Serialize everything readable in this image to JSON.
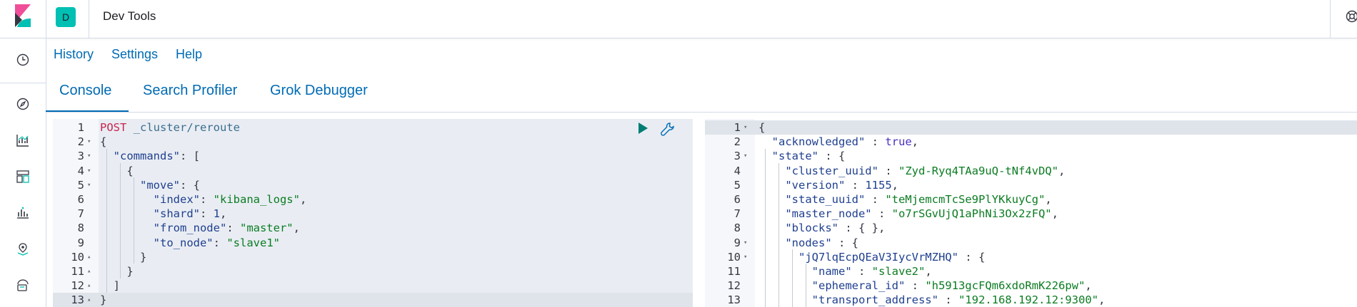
{
  "header": {
    "space_initial": "D",
    "app_title": "Dev Tools",
    "brand_colors": {
      "space": "#00bfb3",
      "link": "#006bb4"
    }
  },
  "nav": {
    "icons": [
      "clock-icon",
      "compass-icon",
      "visualize-icon",
      "dashboard-icon",
      "canvas-icon",
      "maps-icon",
      "ml-icon"
    ]
  },
  "topmenu": {
    "history": "History",
    "settings": "Settings",
    "help": "Help"
  },
  "tabs": [
    {
      "label": "Console",
      "active": true
    },
    {
      "label": "Search Profiler",
      "active": false
    },
    {
      "label": "Grok Debugger",
      "active": false
    }
  ],
  "request": {
    "lines": [
      {
        "n": "1",
        "fold": "",
        "text": [
          [
            "c-method",
            "POST"
          ],
          [
            "c-punc",
            " "
          ],
          [
            "c-url",
            "_cluster/reroute"
          ]
        ]
      },
      {
        "n": "2",
        "fold": "▾",
        "text": [
          [
            "c-punc",
            "{"
          ]
        ]
      },
      {
        "n": "3",
        "fold": "▾",
        "text": [
          [
            "c-punc",
            "  "
          ],
          [
            "c-key",
            "\"commands\""
          ],
          [
            "c-punc",
            ": ["
          ]
        ]
      },
      {
        "n": "4",
        "fold": "▾",
        "text": [
          [
            "c-punc",
            "    {"
          ]
        ]
      },
      {
        "n": "5",
        "fold": "▾",
        "text": [
          [
            "c-punc",
            "      "
          ],
          [
            "c-key",
            "\"move\""
          ],
          [
            "c-punc",
            ": {"
          ]
        ]
      },
      {
        "n": "6",
        "fold": "",
        "text": [
          [
            "c-punc",
            "        "
          ],
          [
            "c-key",
            "\"index\""
          ],
          [
            "c-punc",
            ": "
          ],
          [
            "c-str",
            "\"kibana_logs\""
          ],
          [
            "c-punc",
            ","
          ]
        ]
      },
      {
        "n": "7",
        "fold": "",
        "text": [
          [
            "c-punc",
            "        "
          ],
          [
            "c-key",
            "\"shard\""
          ],
          [
            "c-punc",
            ": "
          ],
          [
            "c-num",
            "1"
          ],
          [
            "c-punc",
            ","
          ]
        ]
      },
      {
        "n": "8",
        "fold": "",
        "text": [
          [
            "c-punc",
            "        "
          ],
          [
            "c-key",
            "\"from_node\""
          ],
          [
            "c-punc",
            ": "
          ],
          [
            "c-str",
            "\"master\""
          ],
          [
            "c-punc",
            ","
          ]
        ]
      },
      {
        "n": "9",
        "fold": "",
        "text": [
          [
            "c-punc",
            "        "
          ],
          [
            "c-key",
            "\"to_node\""
          ],
          [
            "c-punc",
            ": "
          ],
          [
            "c-str",
            "\"slave1\""
          ]
        ]
      },
      {
        "n": "10",
        "fold": "▴",
        "text": [
          [
            "c-punc",
            "      }"
          ]
        ]
      },
      {
        "n": "11",
        "fold": "▴",
        "text": [
          [
            "c-punc",
            "    }"
          ]
        ]
      },
      {
        "n": "12",
        "fold": "▴",
        "text": [
          [
            "c-punc",
            "  ]"
          ]
        ]
      },
      {
        "n": "13",
        "fold": "▴",
        "text": [
          [
            "c-punc",
            "}"
          ]
        ]
      }
    ]
  },
  "response": {
    "lines": [
      {
        "n": "1",
        "fold": "▾",
        "text": [
          [
            "c-punc",
            "{"
          ]
        ]
      },
      {
        "n": "2",
        "fold": "",
        "text": [
          [
            "c-punc",
            "  "
          ],
          [
            "c-key",
            "\"acknowledged\""
          ],
          [
            "c-punc",
            " : "
          ],
          [
            "c-bool",
            "true"
          ],
          [
            "c-punc",
            ","
          ]
        ]
      },
      {
        "n": "3",
        "fold": "▾",
        "text": [
          [
            "c-punc",
            "  "
          ],
          [
            "c-key",
            "\"state\""
          ],
          [
            "c-punc",
            " : {"
          ]
        ]
      },
      {
        "n": "4",
        "fold": "",
        "text": [
          [
            "c-punc",
            "    "
          ],
          [
            "c-key",
            "\"cluster_uuid\""
          ],
          [
            "c-punc",
            " : "
          ],
          [
            "c-str",
            "\"Zyd-Ryq4TAa9uQ-tNf4vDQ\""
          ],
          [
            "c-punc",
            ","
          ]
        ]
      },
      {
        "n": "5",
        "fold": "",
        "text": [
          [
            "c-punc",
            "    "
          ],
          [
            "c-key",
            "\"version\""
          ],
          [
            "c-punc",
            " : "
          ],
          [
            "c-num",
            "1155"
          ],
          [
            "c-punc",
            ","
          ]
        ]
      },
      {
        "n": "6",
        "fold": "",
        "text": [
          [
            "c-punc",
            "    "
          ],
          [
            "c-key",
            "\"state_uuid\""
          ],
          [
            "c-punc",
            " : "
          ],
          [
            "c-str",
            "\"teMjemcmTcSe9PlYKkuyCg\""
          ],
          [
            "c-punc",
            ","
          ]
        ]
      },
      {
        "n": "7",
        "fold": "",
        "text": [
          [
            "c-punc",
            "    "
          ],
          [
            "c-key",
            "\"master_node\""
          ],
          [
            "c-punc",
            " : "
          ],
          [
            "c-str",
            "\"o7rSGvUjQ1aPhNi3Ox2zFQ\""
          ],
          [
            "c-punc",
            ","
          ]
        ]
      },
      {
        "n": "8",
        "fold": "",
        "text": [
          [
            "c-punc",
            "    "
          ],
          [
            "c-key",
            "\"blocks\""
          ],
          [
            "c-punc",
            " : { },"
          ]
        ]
      },
      {
        "n": "9",
        "fold": "▾",
        "text": [
          [
            "c-punc",
            "    "
          ],
          [
            "c-key",
            "\"nodes\""
          ],
          [
            "c-punc",
            " : {"
          ]
        ]
      },
      {
        "n": "10",
        "fold": "▾",
        "text": [
          [
            "c-punc",
            "      "
          ],
          [
            "c-key",
            "\"jQ7lqEcpQEaV3IycVrMZHQ\""
          ],
          [
            "c-punc",
            " : {"
          ]
        ]
      },
      {
        "n": "11",
        "fold": "",
        "text": [
          [
            "c-punc",
            "        "
          ],
          [
            "c-key",
            "\"name\""
          ],
          [
            "c-punc",
            " : "
          ],
          [
            "c-str",
            "\"slave2\""
          ],
          [
            "c-punc",
            ","
          ]
        ]
      },
      {
        "n": "12",
        "fold": "",
        "text": [
          [
            "c-punc",
            "        "
          ],
          [
            "c-key",
            "\"ephemeral_id\""
          ],
          [
            "c-punc",
            " : "
          ],
          [
            "c-str",
            "\"h5913gcFQm6xdoRmK226pw\""
          ],
          [
            "c-punc",
            ","
          ]
        ]
      },
      {
        "n": "13",
        "fold": "",
        "text": [
          [
            "c-punc",
            "        "
          ],
          [
            "c-key",
            "\"transport_address\""
          ],
          [
            "c-punc",
            " : "
          ],
          [
            "c-str",
            "\"192.168.192.12:9300\""
          ],
          [
            "c-punc",
            ","
          ]
        ]
      }
    ]
  }
}
